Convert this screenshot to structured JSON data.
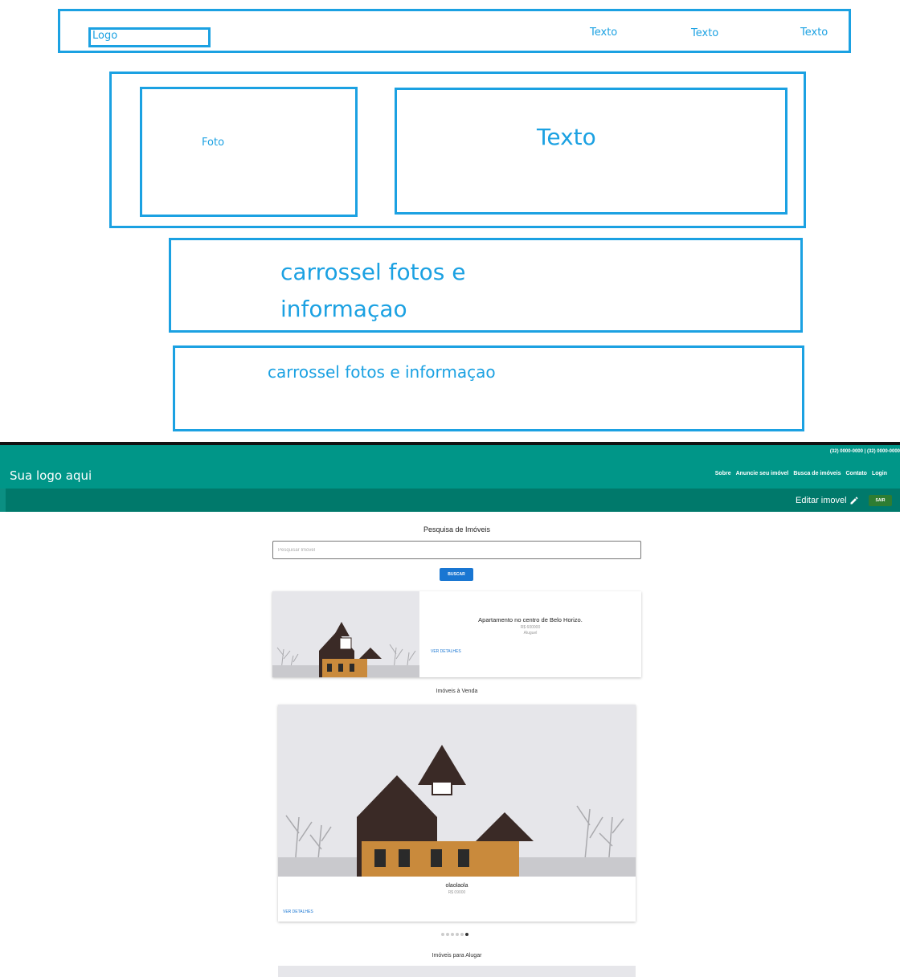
{
  "wireframe": {
    "logo": "Logo",
    "nav_items": [
      "Texto",
      "Texto",
      "Texto"
    ],
    "photo": "Foto",
    "text": "Texto",
    "carousel_1": [
      "carrossel fotos e",
      "informaçao"
    ],
    "carousel_2": "carrossel fotos e informaçao"
  },
  "header": {
    "brand": "Sua logo aqui",
    "phone": "(32) 0000-0000 | (32) 0000-0000",
    "menu": [
      "Sobre",
      "Anuncie seu imóvel",
      "Busca de imóveis",
      "Contato",
      "Login"
    ],
    "edit_label": "Editar imovel",
    "logout_label": "SAIR",
    "colors": {
      "primary": "#009688",
      "secondary": "#00796b",
      "logout": "#2e7d32"
    }
  },
  "search": {
    "title": "Pesquisa de Imóveis",
    "placeholder": "Pesquisar Imóvel",
    "button": "BUSCAR",
    "button_color": "#1976d2"
  },
  "featured": {
    "title": "Apartamento no centro de Belo Horizo.",
    "price": "R$ 600000",
    "type": "Aluguel",
    "link": "VER DETALHES"
  },
  "sale": {
    "section_title": "Imóveis à Venda",
    "card_title": "olaolaola",
    "price": "R$ 09000",
    "link": "VER DETALHES",
    "carousel_dots": 6,
    "active_dot": 6
  },
  "rent": {
    "section_title": "Imóveis para Alugar"
  }
}
